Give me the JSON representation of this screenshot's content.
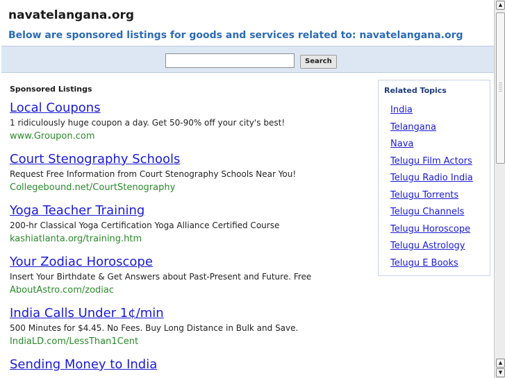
{
  "header": {
    "title": "navatelangana.org",
    "subtitle": "Below are sponsored listings for goods and services related to: navatelangana.org"
  },
  "search": {
    "value": "",
    "button_label": "Search"
  },
  "listings": {
    "heading": "Sponsored Listings",
    "items": [
      {
        "title": "Local Coupons",
        "description": "1 ridiculously huge coupon a day. Get 50-90% off your city's best!",
        "url": "www.Groupon.com"
      },
      {
        "title": "Court Stenography Schools",
        "description": "Request Free Information from Court Stenography Schools Near You!",
        "url": "Collegebound.net/CourtStenography"
      },
      {
        "title": "Yoga Teacher Training",
        "description": "200-hr Classical Yoga Certification Yoga Alliance Certified Course",
        "url": "kashiatlanta.org/training.htm"
      },
      {
        "title": "Your Zodiac Horoscope",
        "description": "Insert Your Birthdate & Get Answers about Past-Present and Future. Free",
        "url": "AboutAstro.com/zodiac"
      },
      {
        "title": "India Calls Under 1¢/min",
        "description": "500 Minutes for $4.45. No Fees. Buy Long Distance in Bulk and Save.",
        "url": "IndiaLD.com/LessThan1Cent"
      },
      {
        "title": "Sending Money to India",
        "description": "",
        "url": ""
      }
    ]
  },
  "related": {
    "heading": "Related Topics",
    "items": [
      "India",
      "Telangana",
      "Nava",
      "Telugu Film Actors",
      "Telugu Radio India",
      "Telugu Torrents",
      "Telugu Channels",
      "Telugu Horoscope",
      "Telugu Astrology",
      "Telugu E Books"
    ]
  },
  "scrollbar": {
    "up_icon": "arrow-up-icon",
    "down_icon": "arrow-down-icon",
    "scroll_position_fraction": 0
  }
}
